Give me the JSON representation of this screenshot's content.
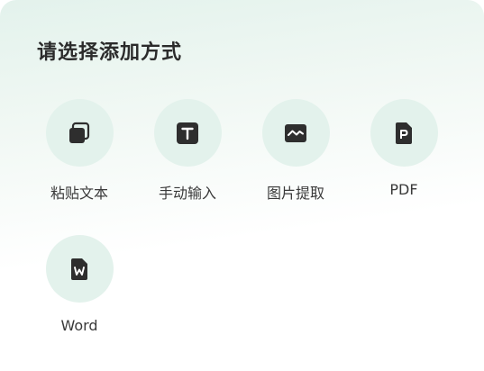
{
  "sheet": {
    "title": "请选择添加方式"
  },
  "options": [
    {
      "label": "粘贴文本",
      "icon": "copy-icon"
    },
    {
      "label": "手动输入",
      "icon": "text-icon"
    },
    {
      "label": "图片提取",
      "icon": "image-icon"
    },
    {
      "label": "PDF",
      "icon": "pdf-file-icon"
    },
    {
      "label": "Word",
      "icon": "word-file-icon"
    }
  ],
  "colors": {
    "circle_background": "#e3f2ec",
    "icon": "#2e2e2e",
    "title": "#2b2b2b",
    "label": "#3a3a3a"
  }
}
